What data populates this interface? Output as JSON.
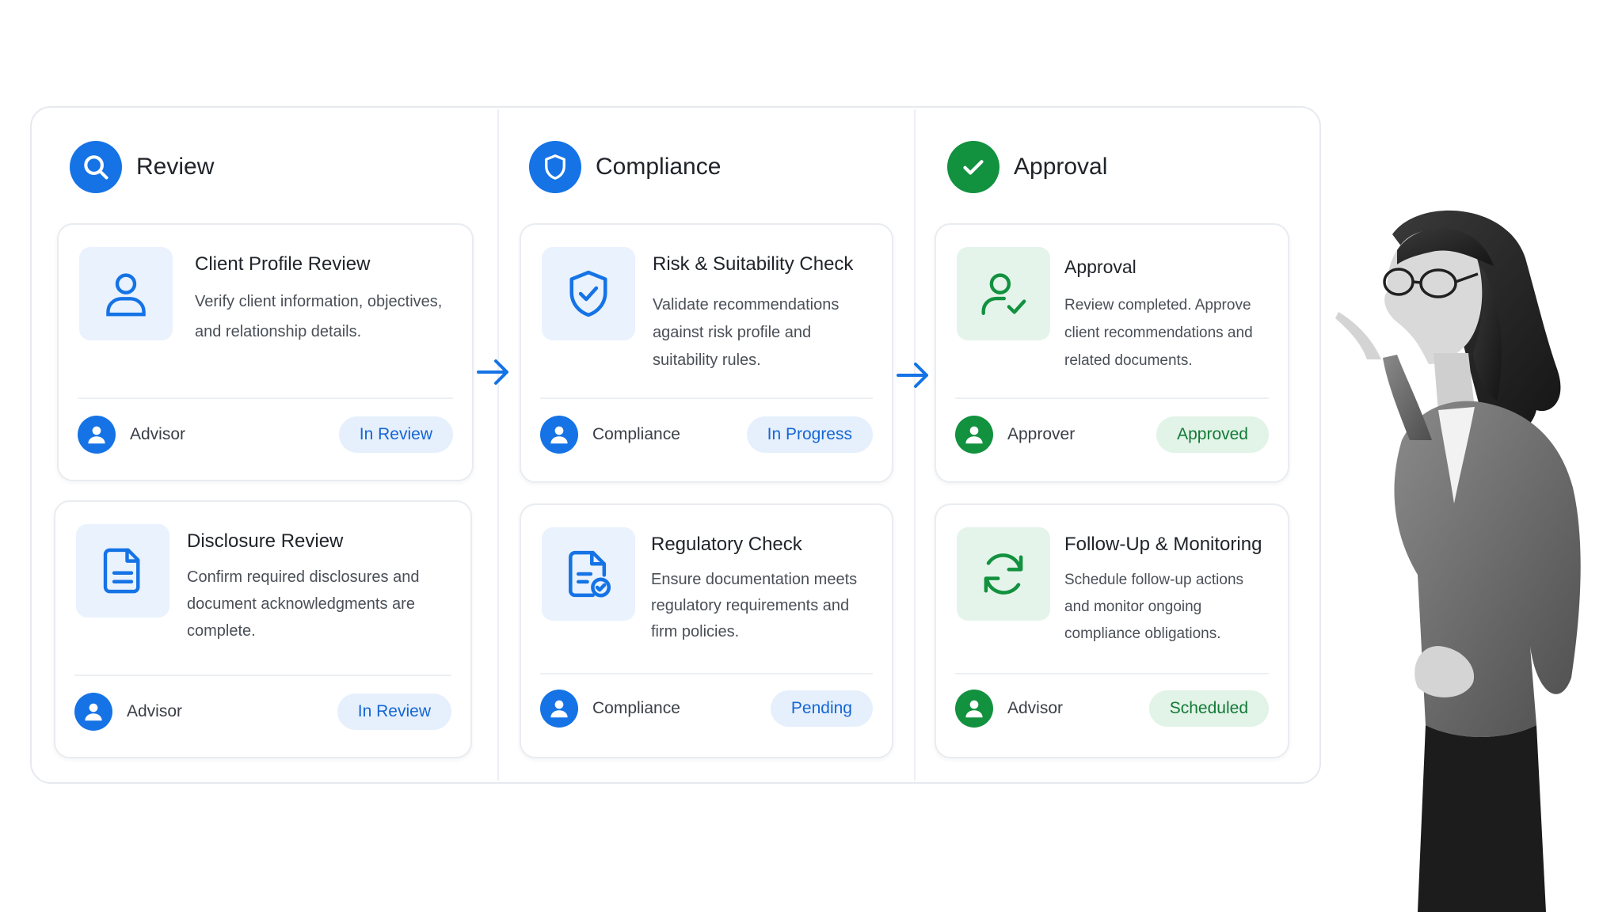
{
  "colors": {
    "accent_blue": "#1573e6",
    "accent_green": "#12913f",
    "pill_blue_bg": "#e6f0fc",
    "pill_green_bg": "#e2f3e7"
  },
  "stages": [
    {
      "title": "Review",
      "icon": "search-icon",
      "cards": [
        {
          "title": "Client Profile Review",
          "description": "Verify client information, objectives, and relationship details.",
          "icon": "user-icon",
          "role": "Advisor",
          "status": "In Review"
        },
        {
          "title": "Disclosure Review",
          "description": "Confirm required disclosures and document acknowledgments are complete.",
          "icon": "document-icon",
          "role": "Advisor",
          "status": "In Review"
        }
      ]
    },
    {
      "title": "Compliance",
      "icon": "shield-icon",
      "cards": [
        {
          "title": "Risk & Suitability Check",
          "description": "Validate recommendations against risk profile and suitability rules.",
          "icon": "shield-check-icon",
          "role": "Compliance",
          "status": "In Progress"
        },
        {
          "title": "Regulatory Check",
          "description": "Ensure documentation meets regulatory requirements and firm policies.",
          "icon": "document-check-icon",
          "role": "Compliance",
          "status": "Pending"
        }
      ]
    },
    {
      "title": "Approval",
      "icon": "check-icon",
      "cards": [
        {
          "title": "Approval",
          "description": "Review completed. Approve client recommendations and related documents.",
          "icon": "user-check-icon",
          "role": "Approver",
          "status": "Approved"
        },
        {
          "title": "Follow-Up & Monitoring",
          "description": "Schedule follow-up actions and monitor ongoing compliance obligations.",
          "icon": "refresh-icon",
          "role": "Advisor",
          "status": "Scheduled"
        }
      ]
    }
  ]
}
